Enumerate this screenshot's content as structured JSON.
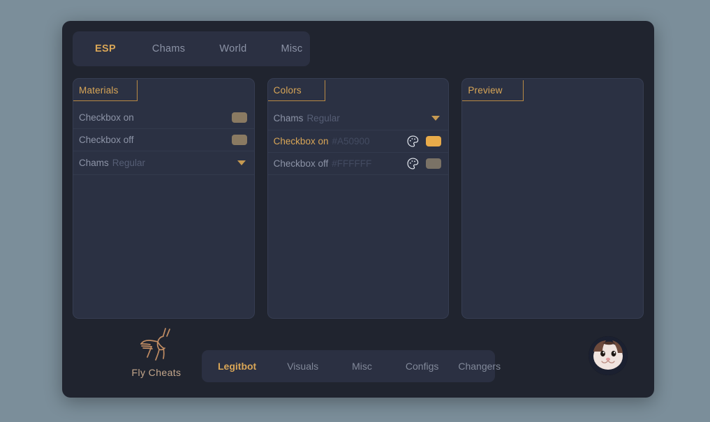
{
  "top_tabs": [
    {
      "label": "ESP",
      "active": true
    },
    {
      "label": "Chams",
      "active": false
    },
    {
      "label": "World",
      "active": false
    },
    {
      "label": "Misc",
      "active": false
    }
  ],
  "materials_panel": {
    "title": "Materials",
    "rows": [
      {
        "label": "Checkbox on",
        "swatch": "#8a7a62"
      },
      {
        "label": "Checkbox off",
        "swatch": "#8a7a62"
      }
    ],
    "dropdown": {
      "main": "Chams",
      "sub": "Regular"
    }
  },
  "colors_panel": {
    "title": "Colors",
    "dropdown": {
      "main": "Chams",
      "sub": "Regular"
    },
    "rows": [
      {
        "label": "Checkbox on",
        "hex": "#A50900",
        "swatch": "#e8ab4a",
        "icon": "palette-icon",
        "highlighted": true
      },
      {
        "label": "Checkbox off",
        "hex": "#FFFFFF",
        "swatch": "#7a7266",
        "icon": "palette-icon",
        "highlighted": false
      }
    ]
  },
  "preview_panel": {
    "title": "Preview"
  },
  "branding": {
    "logo_icon": "pegasus-logo-icon",
    "name": "Fly Cheats"
  },
  "bottom_nav": [
    {
      "label": "Legitbot",
      "active": true
    },
    {
      "label": "Visuals",
      "active": false
    },
    {
      "label": "Misc",
      "active": false
    },
    {
      "label": "Configs",
      "active": false
    },
    {
      "label": "Changers",
      "active": false
    }
  ],
  "avatar": {
    "icon": "cat-avatar-icon"
  },
  "theme": {
    "accent": "#d9a657",
    "window_bg": "#20242f",
    "panel_bg": "#2b3143",
    "desktop_bg": "#7b8e9a"
  }
}
